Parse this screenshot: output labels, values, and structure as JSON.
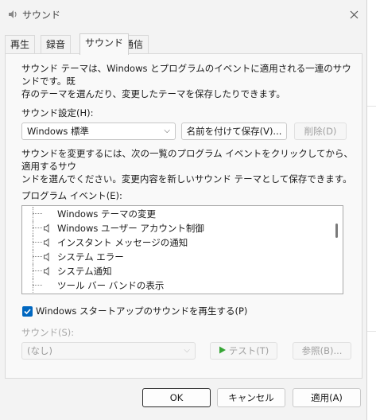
{
  "window": {
    "title": "サウンド"
  },
  "tabs": [
    {
      "label": "再生"
    },
    {
      "label": "録音"
    },
    {
      "label": "サウンド"
    },
    {
      "label": "通信"
    }
  ],
  "description": "サウンド テーマは、Windows とプログラムのイベントに適用される一連のサウンドです。既存のテーマを選んだり、変更したテーマを保存したりできます。",
  "description_lines": [
    "サウンド テーマは、Windows とプログラムのイベントに適用される一連のサウンドです。既",
    "存のテーマを選んだり、変更したテーマを保存したりできます。"
  ],
  "scheme": {
    "label": "サウンド設定(H):",
    "selected": "Windows 標準",
    "save_as_label": "名前を付けて保存(V)...",
    "delete_label": "削除(D)"
  },
  "instructions_lines": [
    "サウンドを変更するには、次の一覧のプログラム イベントをクリックしてから、適用するサウ",
    "ンドを選んでください。変更内容を新しいサウンド テーマとして保存できます。"
  ],
  "events": {
    "label": "プログラム イベント(E):",
    "items": [
      {
        "label": "Windows テーマの変更",
        "has_sound": false
      },
      {
        "label": "Windows ユーザー アカウント制御",
        "has_sound": true
      },
      {
        "label": "インスタント メッセージの通知",
        "has_sound": true
      },
      {
        "label": "システム エラー",
        "has_sound": true
      },
      {
        "label": "システム通知",
        "has_sound": true
      },
      {
        "label": "ツール バー バンドの表示",
        "has_sound": false
      }
    ]
  },
  "startup_sound": {
    "label": "Windows スタートアップのサウンドを再生する(P)",
    "checked": true
  },
  "sound": {
    "label": "サウンド(S):",
    "selected": "(なし)",
    "test_label": "テスト(T)",
    "browse_label": "参照(B)..."
  },
  "footer": {
    "ok_label": "OK",
    "cancel_label": "キャンセル",
    "apply_label": "適用(A)"
  },
  "colors": {
    "accent": "#0067c0",
    "play_icon": "#36a535"
  }
}
